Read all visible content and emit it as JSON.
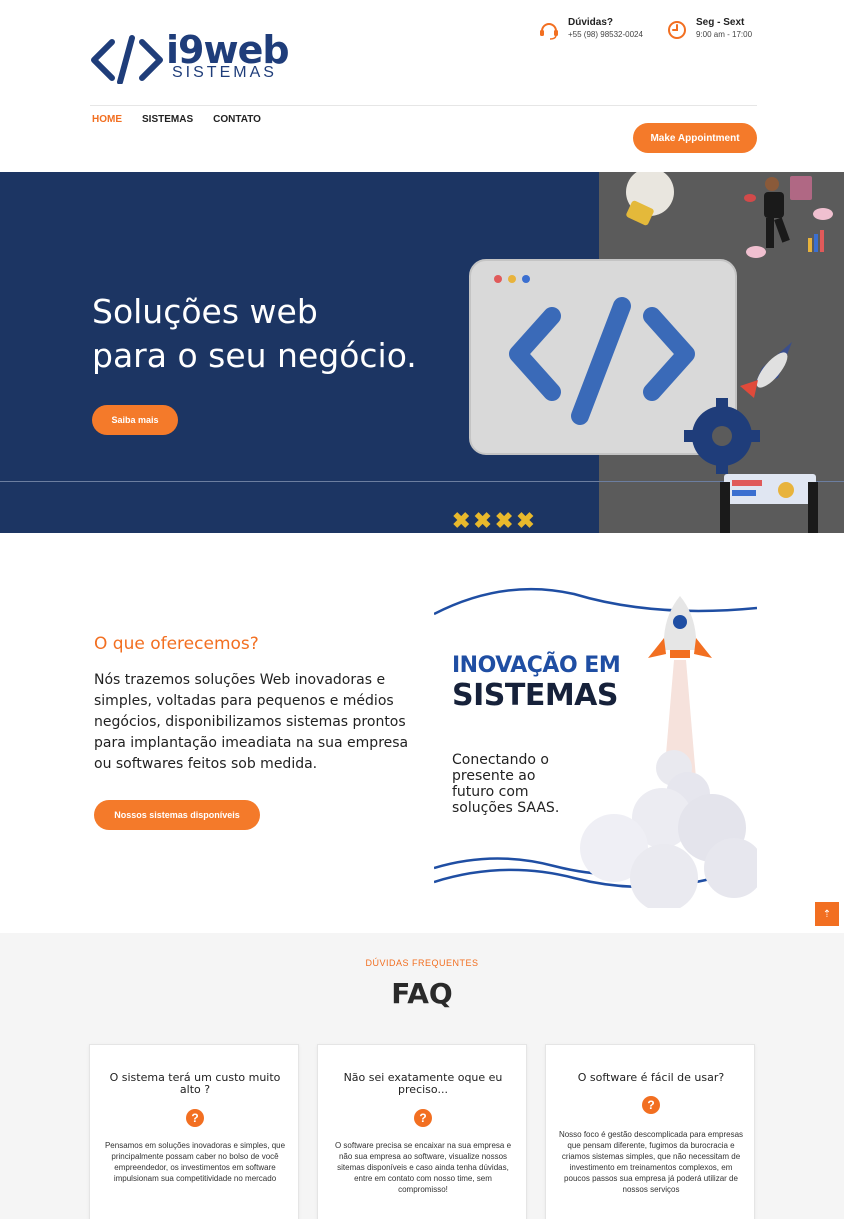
{
  "brand": {
    "name": "i9web",
    "subtitle": "SISTEMAS",
    "color": "#1f3d7a"
  },
  "contact": [
    {
      "icon": "headset-icon",
      "title": "Dúvidas?",
      "detail": "+55 (98) 98532-0024"
    },
    {
      "icon": "clock-icon",
      "title": "Seg - Sext",
      "detail": "9:00 am - 17:00"
    }
  ],
  "nav": {
    "home": "HOME",
    "sistemas": "SISTEMAS",
    "contato": "CONTATO"
  },
  "header": {
    "appointment_label": "Make Appointment"
  },
  "hero": {
    "line1": "Soluções web",
    "line2": "para o seu negócio.",
    "button": "Saiba mais",
    "marks": "✖✖✖✖"
  },
  "offer": {
    "title": "O que oferecemos?",
    "text": "Nós trazemos soluções Web inovadoras e simples, voltadas para pequenos e médios negócios, disponibilizamos sistemas prontos para implantação imeadiata na sua empresa ou softwares feitos sob medida.",
    "button": "Nossos sistemas disponíveis"
  },
  "promo": {
    "headline1": "INOVAÇÃO EM",
    "headline2": "SISTEMAS",
    "tagline": "Conectando o presente ao futuro com soluções SAAS."
  },
  "scroll_top": "⇡",
  "faq": {
    "kicker": "DÚVIDAS FREQUENTES",
    "title": "FAQ",
    "items": [
      {
        "question": "O sistema terá um custo muito alto ?",
        "answer": "Pensamos em soluções inovadoras e simples, que principalmente possam caber no bolso de você empreendedor, os investimentos em software impulsionam sua competitividade no mercado"
      },
      {
        "question": "Não sei exatamente oque eu preciso...",
        "answer": "O software precisa se encaixar na sua empresa e não sua empresa ao software, visualize nossos sitemas disponíveis e caso ainda tenha dúvidas, entre em contato com nosso time, sem compromisso!"
      },
      {
        "question": "O software é fácil de usar?",
        "answer": "Nosso foco é gestão descomplicada para empresas que pensam diferente, fugimos da burocracia e criamos sistemas simples, que não necessitam de investimento em treinamentos complexos, em poucos passos sua empresa já poderá utilizar de nossos serviços"
      }
    ],
    "icon_glyph": "?"
  },
  "colors": {
    "accent": "#f47a2a",
    "hero_bg": "#1c3563",
    "faq_bg": "#f5f5f5"
  }
}
